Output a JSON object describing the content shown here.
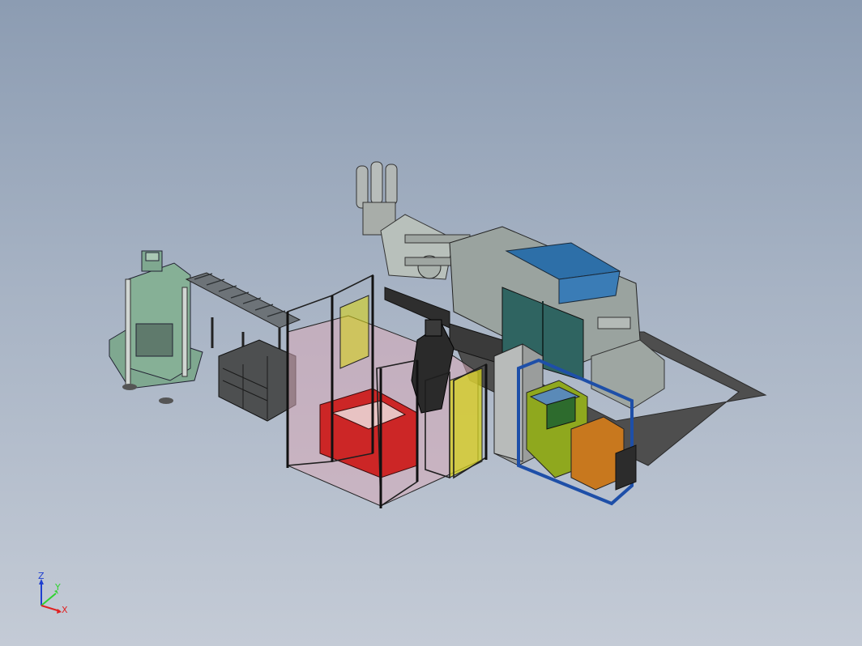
{
  "viewport": {
    "background_top": "#8c9cb2",
    "background_bottom": "#c4cbd6"
  },
  "triad": {
    "x_label": "X",
    "y_label": "Y",
    "z_label": "Z",
    "x_color": "#e02222",
    "y_color": "#2fd32f",
    "z_color": "#1f3fd0"
  },
  "colors": {
    "press_green": "#7fa890",
    "conveyor_gray": "#6d7378",
    "fence_dark": "#2a2a2a",
    "fence_yellow": "#d6d21e",
    "red_enclosure": "#cc2626",
    "pink_floor": "#d7aab8",
    "machine_gray": "#9aa39f",
    "machine_teal": "#2f6461",
    "blue_cover": "#2d6fa8",
    "panel_yellow_green": "#8fa81e",
    "frame_blue": "#1e4fa8",
    "orange_cabinet": "#c8781e",
    "floor_outline": "#4e4e4e"
  }
}
